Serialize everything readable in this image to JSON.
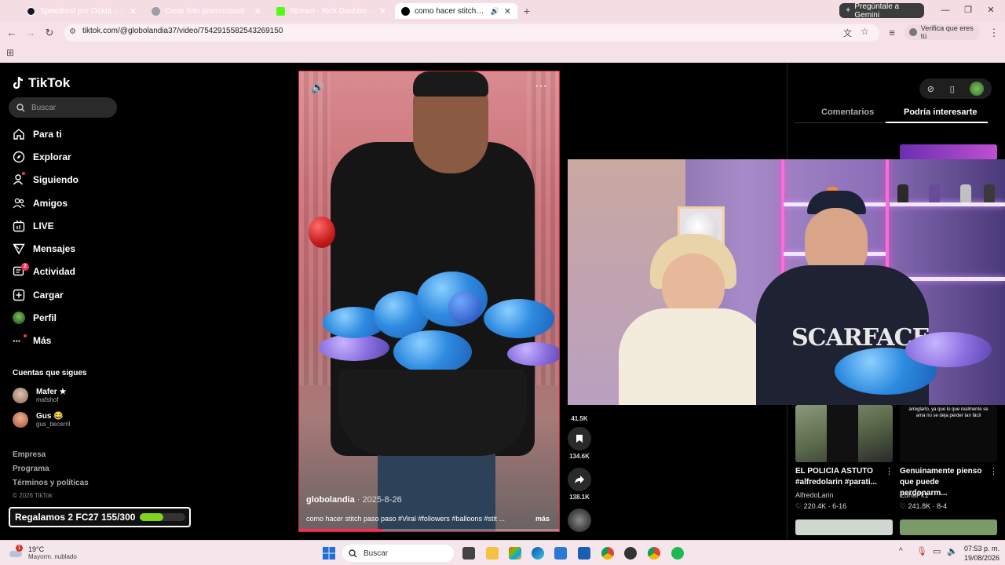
{
  "browser": {
    "tabs": [
      {
        "title": "Speedtest por Ookla - La prueb",
        "active": false,
        "icon_color": "#141526"
      },
      {
        "title": "Crear foto promocional",
        "active": false,
        "icon_color": "#9aa0a6"
      },
      {
        "title": "Stream - Kick Dashboard",
        "active": false,
        "icon_color": "#53fc18"
      },
      {
        "title": "como hacer stitch paso par",
        "active": true,
        "icon_color": "#000000"
      }
    ],
    "gemini_label": "Pregúntale a Gemini",
    "url": "tiktok.com/@globolandia37/video/7542915582543269150",
    "verify_label": "Verifica que eres tú"
  },
  "tiktok": {
    "logo_text": "TikTok",
    "search_placeholder": "Buscar",
    "nav": [
      {
        "label": "Para ti",
        "icon": "home-icon"
      },
      {
        "label": "Explorar",
        "icon": "compass-icon"
      },
      {
        "label": "Siguiendo",
        "icon": "following-icon"
      },
      {
        "label": "Amigos",
        "icon": "friends-icon"
      },
      {
        "label": "LIVE",
        "icon": "live-icon"
      },
      {
        "label": "Mensajes",
        "icon": "messages-icon"
      },
      {
        "label": "Actividad",
        "icon": "activity-icon",
        "badge": "2"
      },
      {
        "label": "Cargar",
        "icon": "upload-icon"
      },
      {
        "label": "Perfil",
        "icon": "profile-icon"
      },
      {
        "label": "Más",
        "icon": "more-icon"
      }
    ],
    "following_header": "Cuentas que sigues",
    "following": [
      {
        "name": "Mafer ★",
        "username": "mafshof",
        "color": "#b08a7a"
      },
      {
        "name": "Gus 😂",
        "username": "gus_becerril",
        "color": "#c98a6a"
      }
    ],
    "footer_links": [
      "Empresa",
      "Programa",
      "Términos y políticas"
    ],
    "copyright": "© 2026 TikTok",
    "promo": {
      "text": "Regalamos 2 FC27 155/300",
      "progress": 0.517
    }
  },
  "video": {
    "author": "globolandia",
    "date": "2025-8-26",
    "caption": "como hacer stitch paso paso #Viral #followers #balloons #stit ...",
    "more_label": "más",
    "progress": 0.32
  },
  "actions": [
    {
      "icon": "heart-icon",
      "count": "41.5K"
    },
    {
      "icon": "bookmark-icon",
      "count": "134.6K"
    },
    {
      "icon": "share-icon",
      "count": "138.1K"
    }
  ],
  "right_panel": {
    "tabs": [
      "Comentarios",
      "Podría interesarte"
    ],
    "active_tab": 1,
    "cards": [
      {
        "title": "EL POLICIA ASTUTO #alfredolarin #parati...",
        "author": "AlfredoLarin",
        "likes": "220.4K",
        "date": "6-16",
        "overlay": ""
      },
      {
        "title": "Genuinamente pienso que puede perdonarm...",
        "author": "EdnaPk1",
        "likes": "241.8K",
        "date": "8-4",
        "overlay": "arreglarlo, ya que lo que realmente se ama no se deja perder tan fácil"
      }
    ]
  },
  "taskbar": {
    "temp": "19°C",
    "condition": "Mayorm. nublado",
    "alert_badge": "1",
    "search_label": "Buscar",
    "time": "07:53 p. m.",
    "date": "19/08/2026"
  }
}
